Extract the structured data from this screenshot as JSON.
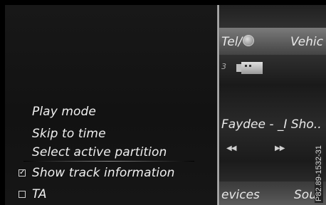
{
  "menu": {
    "items": [
      {
        "label": "Play mode",
        "checkbox": null
      },
      {
        "label": "Skip to time",
        "checkbox": null
      },
      {
        "label": "Select active partition",
        "checkbox": null
      },
      {
        "label": "Show track information",
        "checkbox": "checked"
      },
      {
        "label": "TA",
        "checkbox": "unchecked"
      }
    ]
  },
  "background": {
    "top_tabs": [
      "Tel/",
      "Vehic"
    ],
    "source_number": "3",
    "track_title": "Faydee - _I Sho..",
    "prev_icon": "skip-back-icon",
    "next_icon": "skip-forward-icon",
    "bottom_tabs": [
      "evices",
      "Sou"
    ]
  },
  "reference_code": "P82.89-1532-31",
  "colors": {
    "menu_bg": "#161616",
    "text": "#f0f0f0",
    "divider": "#cfcfcf"
  }
}
